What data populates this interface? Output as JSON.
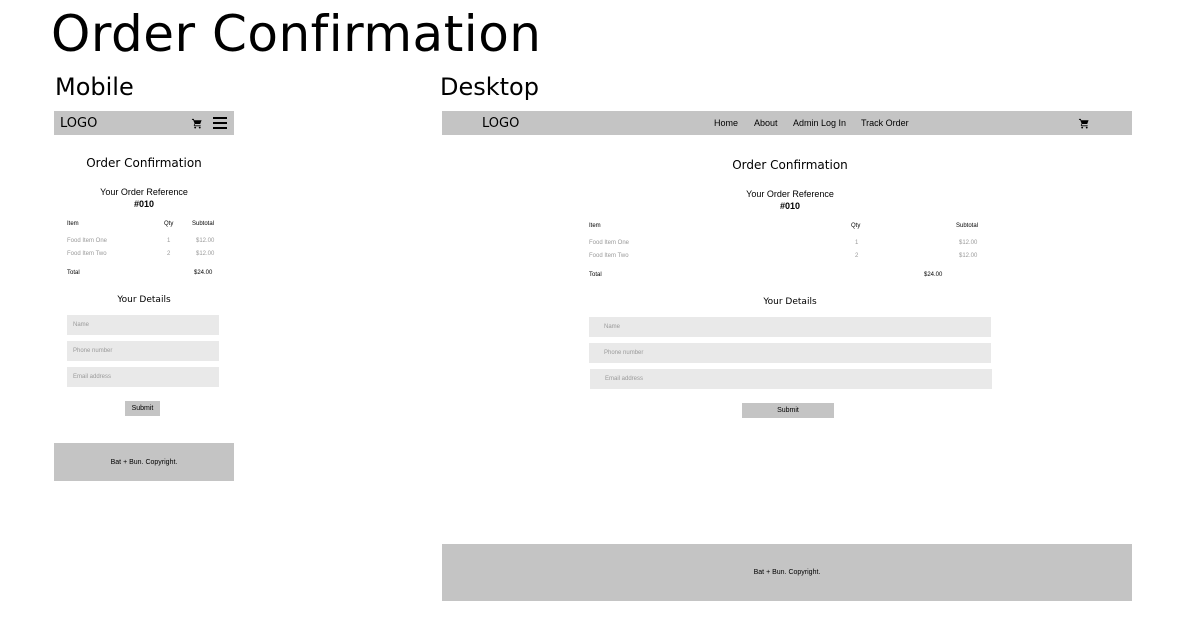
{
  "page_title": "Order Confirmation",
  "mobile_label": "Mobile",
  "desktop_label": "Desktop",
  "navbar": {
    "logo": "LOGO",
    "links": [
      "Home",
      "About",
      "Admin Log In",
      "Track Order"
    ],
    "cart_icon": "cart-icon",
    "menu_icon": "hamburger-icon"
  },
  "content": {
    "heading": "Order Confirmation",
    "reference_label": "Your Order Reference",
    "reference_number": "#010",
    "table": {
      "headers": [
        "Item",
        "Qty",
        "Subtotal"
      ],
      "rows": [
        [
          "Food Item One",
          "1",
          "$12.00"
        ],
        [
          "Food Item Two",
          "2",
          "$12.00"
        ]
      ],
      "total_label": "Total",
      "total_value": "$24.00"
    },
    "details_heading": "Your Details",
    "fields": {
      "name_placeholder": "Name",
      "phone_placeholder": "Phone number",
      "email_placeholder": "Email address"
    },
    "submit_label": "Submit"
  },
  "footer": {
    "text": "Bat + Bun. Copyright."
  },
  "colors": {
    "navbar": "#c4c4c4",
    "field": "#e9e9e9",
    "muted_text": "#9a9a9a"
  }
}
